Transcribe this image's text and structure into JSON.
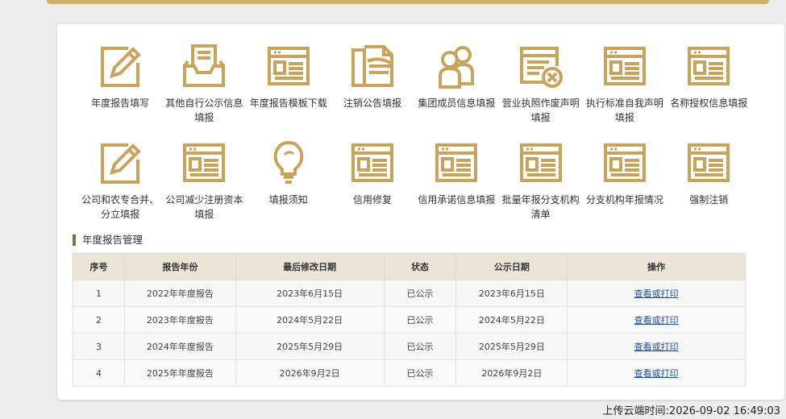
{
  "accent_color": "#c9a35a",
  "tiles": [
    {
      "label": "年度报告填写",
      "icon": "edit-icon"
    },
    {
      "label": "其他自行公示信息填报",
      "icon": "inbox-tray-icon"
    },
    {
      "label": "年度报告模板下载",
      "icon": "form-document-icon"
    },
    {
      "label": "注销公告填报",
      "icon": "document-stack-icon"
    },
    {
      "label": "集团成员信息填报",
      "icon": "group-users-icon"
    },
    {
      "label": "营业执照作废声明填报",
      "icon": "license-void-icon"
    },
    {
      "label": "执行标准自我声明填报",
      "icon": "form-document-icon"
    },
    {
      "label": "名称授权信息填报",
      "icon": "form-document-icon"
    },
    {
      "label": "公司和农专合并、分立填报",
      "icon": "edit-icon"
    },
    {
      "label": "公司减少注册资本填报",
      "icon": "form-document-icon"
    },
    {
      "label": "填报须知",
      "icon": "lightbulb-icon"
    },
    {
      "label": "信用修复",
      "icon": "form-document-icon"
    },
    {
      "label": "信用承诺信息填报",
      "icon": "form-document-icon"
    },
    {
      "label": "批量年报分支机构清单",
      "icon": "form-document-icon"
    },
    {
      "label": "分支机构年报情况",
      "icon": "form-document-icon"
    },
    {
      "label": "强制注销",
      "icon": "form-document-icon"
    }
  ],
  "section": {
    "title": "年度报告管理"
  },
  "table": {
    "headers": [
      "序号",
      "报告年份",
      "最后修改日期",
      "状态",
      "公示日期",
      "操作"
    ],
    "rows": [
      [
        "1",
        "2022年年度报告",
        "2023年6月15日",
        "已公示",
        "2023年6月15日",
        "查看或打印"
      ],
      [
        "2",
        "2023年年度报告",
        "2024年5月22日",
        "已公示",
        "2024年5月22日",
        "查看或打印"
      ],
      [
        "3",
        "2024年年度报告",
        "2025年5月29日",
        "已公示",
        "2025年5月29日",
        "查看或打印"
      ],
      [
        "4",
        "2025年年度报告",
        "2026年9月2日",
        "已公示",
        "2026年9月2日",
        "查看或打印"
      ]
    ]
  },
  "footer": {
    "upload_time": "上传云端时间:2026-09-02 16:49:03"
  }
}
